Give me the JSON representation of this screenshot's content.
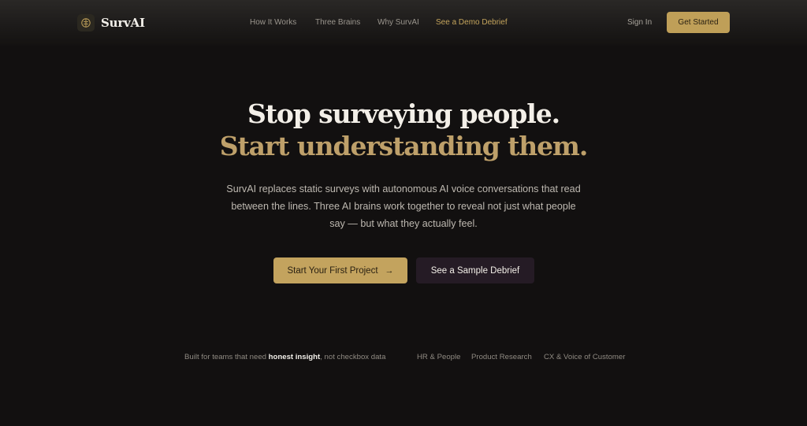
{
  "brand": {
    "name": "SurvAI",
    "icon": "brain-icon"
  },
  "nav": {
    "links": [
      "How It Works",
      "Three Brains",
      "Why SurvAI",
      "See a Demo Debrief"
    ],
    "sign_in": "Sign In",
    "get_started": "Get Started"
  },
  "hero": {
    "headline_line1": "Stop surveying people.",
    "headline_line2": "Start understanding them.",
    "subtext": "SurvAI replaces static surveys with autonomous AI voice conversations that read between the lines. Three AI brains work together to reveal not just what people say — but what they actually feel.",
    "primary_cta": "Start Your First Project",
    "primary_cta_icon": "arrow-right-icon",
    "secondary_cta": "See a Sample Debrief"
  },
  "audience": {
    "prefix": "Built for teams that need ",
    "emphasis": "honest insight",
    "suffix": ", not checkbox data",
    "segments": [
      "HR & People",
      "Product Research",
      "CX & Voice of Customer"
    ]
  },
  "colors": {
    "background": "#121010",
    "accent_gold": "#c3a35e",
    "headline_gold": "#bea06a",
    "secondary_button": "#251b25"
  }
}
